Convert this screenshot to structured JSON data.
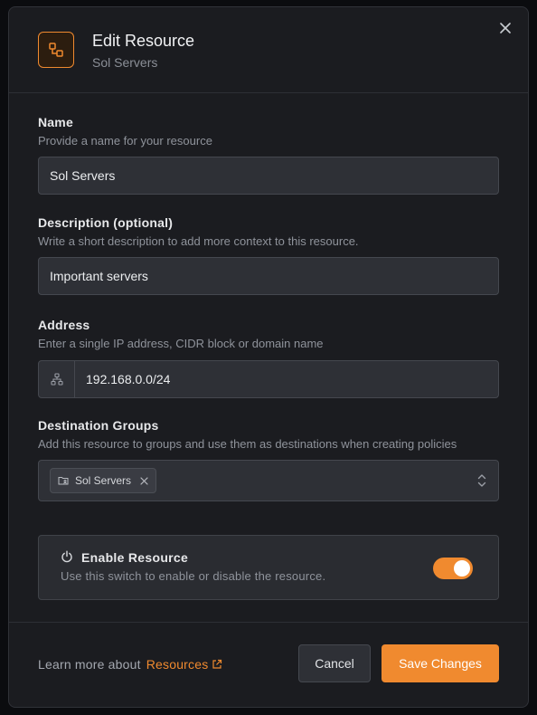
{
  "header": {
    "title": "Edit Resource",
    "subtitle": "Sol Servers",
    "icon": "resource-nodes-icon",
    "close_icon": "close-icon"
  },
  "name_field": {
    "label": "Name",
    "hint": "Provide a name for your resource",
    "value": "Sol Servers"
  },
  "description_field": {
    "label": "Description (optional)",
    "hint": "Write a short description to add more context to this resource.",
    "value": "Important servers"
  },
  "address_field": {
    "label": "Address",
    "hint": "Enter a single IP address, CIDR block or domain name",
    "value": "192.168.0.0/24",
    "icon": "network-icon"
  },
  "destination_groups": {
    "label": "Destination Groups",
    "hint": "Add this resource to groups and use them as destinations when creating policies",
    "chips": [
      {
        "label": "Sol Servers",
        "icon": "folder-users-icon"
      }
    ]
  },
  "enable": {
    "title": "Enable Resource",
    "description": "Use this switch to enable or disable the resource.",
    "enabled": true,
    "icon": "power-icon"
  },
  "footer": {
    "learn_text": "Learn more about",
    "learn_link": "Resources",
    "cancel_label": "Cancel",
    "save_label": "Save Changes"
  },
  "colors": {
    "accent": "#f08a2f",
    "modal_bg": "#1b1c20",
    "input_bg": "#2e3036"
  }
}
